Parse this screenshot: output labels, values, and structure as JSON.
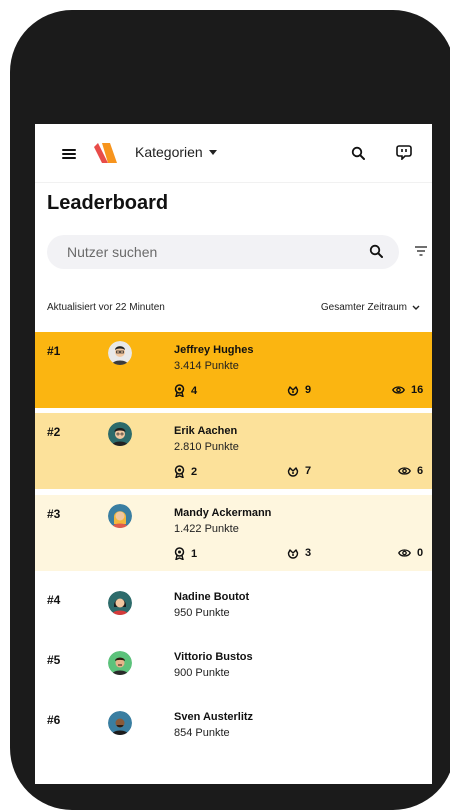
{
  "header": {
    "category_label": "Kategorien",
    "menu_icon": "hamburger-menu-icon",
    "logo": "brand-logo",
    "search_icon": "search-icon",
    "chat_icon": "chat-bubble-icon"
  },
  "page": {
    "title": "Leaderboard",
    "search_placeholder": "Nutzer suchen",
    "updated_text": "Aktualisiert vor 22 Minuten",
    "time_range": "Gesamter Zeitraum"
  },
  "colors": {
    "rank1_bg": "#FBB511",
    "rank2_bg": "#FCE19A",
    "rank3_bg": "#FEF6DE",
    "logo_orange": "#F7941D",
    "logo_red": "#E53935"
  },
  "leaderboard": [
    {
      "rank": "#1",
      "name": "Jeffrey Hughes",
      "points": "3.414 Punkte",
      "badges": "4",
      "likes": "9",
      "views": "16"
    },
    {
      "rank": "#2",
      "name": "Erik Aachen",
      "points": "2.810 Punkte",
      "badges": "2",
      "likes": "7",
      "views": "6"
    },
    {
      "rank": "#3",
      "name": "Mandy Ackermann",
      "points": "1.422 Punkte",
      "badges": "1",
      "likes": "3",
      "views": "0"
    },
    {
      "rank": "#4",
      "name": "Nadine Boutot",
      "points": "950 Punkte"
    },
    {
      "rank": "#5",
      "name": "Vittorio Bustos",
      "points": "900 Punkte"
    },
    {
      "rank": "#6",
      "name": "Sven Austerlitz",
      "points": "854 Punkte"
    }
  ]
}
